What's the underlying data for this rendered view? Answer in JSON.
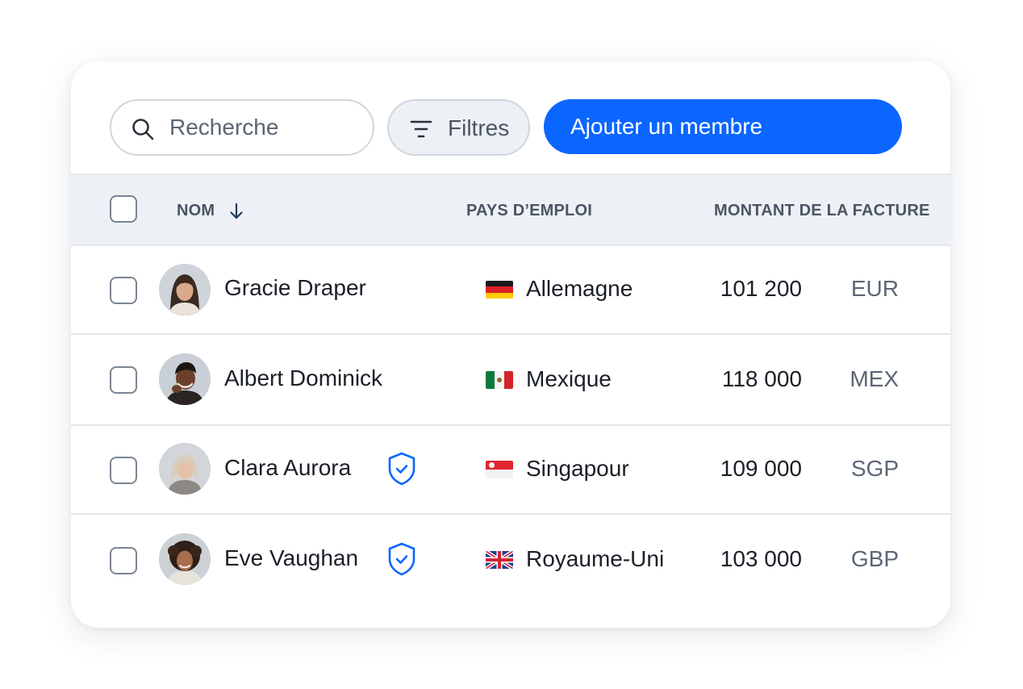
{
  "toolbar": {
    "search_placeholder": "Recherche",
    "filters_label": "Filtres",
    "add_member_label": "Ajouter un membre"
  },
  "table": {
    "columns": {
      "name": "NOM",
      "country": "PAYS D’EMPLOI",
      "amount": "MONTANT DE LA FACTURE"
    },
    "rows": [
      {
        "name": "Gracie Draper",
        "verified": false,
        "flag": "germany-flag",
        "country": "Allemagne",
        "amount": "101 200",
        "currency": "EUR"
      },
      {
        "name": "Albert Dominick",
        "verified": false,
        "flag": "mexico-flag",
        "country": "Mexique",
        "amount": "118 000",
        "currency": "MEX"
      },
      {
        "name": "Clara Aurora",
        "verified": true,
        "flag": "singapore-flag",
        "country": "Singapour",
        "amount": "109 000",
        "currency": "SGP"
      },
      {
        "name": "Eve Vaughan",
        "verified": true,
        "flag": "uk-flag",
        "country": "Royaume-Uni",
        "amount": "103 000",
        "currency": "GBP"
      }
    ]
  },
  "colors": {
    "accent": "#0a66ff",
    "header_bg": "#edf0f5",
    "border": "#cfd6de"
  }
}
